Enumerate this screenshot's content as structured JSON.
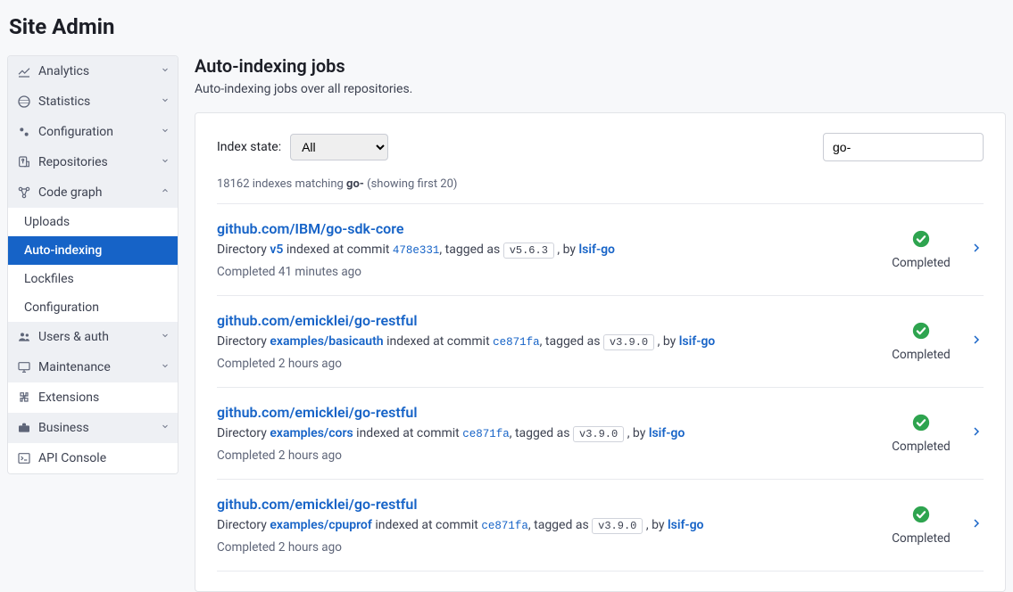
{
  "header": {
    "title": "Site Admin"
  },
  "sidebar": {
    "items": [
      {
        "label": "Analytics",
        "expanded": false
      },
      {
        "label": "Statistics",
        "expanded": false
      },
      {
        "label": "Configuration",
        "expanded": false
      },
      {
        "label": "Repositories",
        "expanded": false
      },
      {
        "label": "Code graph",
        "expanded": true,
        "children": [
          {
            "label": "Uploads",
            "active": false
          },
          {
            "label": "Auto-indexing",
            "active": true
          },
          {
            "label": "Lockfiles",
            "active": false
          },
          {
            "label": "Configuration",
            "active": false
          }
        ]
      },
      {
        "label": "Users & auth",
        "expanded": false
      },
      {
        "label": "Maintenance",
        "expanded": false
      },
      {
        "label": "Extensions",
        "expanded": false
      },
      {
        "label": "Business",
        "expanded": false
      },
      {
        "label": "API Console",
        "expanded": false
      }
    ]
  },
  "main": {
    "title": "Auto-indexing jobs",
    "subtitle": "Auto-indexing jobs over all repositories.",
    "filter": {
      "label": "Index state:",
      "selected": "All",
      "search_value": "go-"
    },
    "count": {
      "prefix": "18162 indexes matching ",
      "query": "go-",
      "suffix": " (showing first 20)"
    },
    "shared": {
      "directory_prefix": "Directory ",
      "indexed_at": " indexed at commit ",
      "tagged_as": ", tagged as ",
      "by_text": ", by ",
      "by_tool": "lsif-go"
    },
    "jobs": [
      {
        "repo": "github.com/IBM/go-sdk-core",
        "dir": "v5",
        "commit": "478e331",
        "tag": "v5.6.3",
        "time": "Completed 41 minutes ago",
        "status": "Completed"
      },
      {
        "repo": "github.com/emicklei/go-restful",
        "dir": "examples/basicauth",
        "commit": "ce871fa",
        "tag": "v3.9.0",
        "time": "Completed 2 hours ago",
        "status": "Completed"
      },
      {
        "repo": "github.com/emicklei/go-restful",
        "dir": "examples/cors",
        "commit": "ce871fa",
        "tag": "v3.9.0",
        "time": "Completed 2 hours ago",
        "status": "Completed"
      },
      {
        "repo": "github.com/emicklei/go-restful",
        "dir": "examples/cpuprof",
        "commit": "ce871fa",
        "tag": "v3.9.0",
        "time": "Completed 2 hours ago",
        "status": "Completed"
      }
    ]
  }
}
